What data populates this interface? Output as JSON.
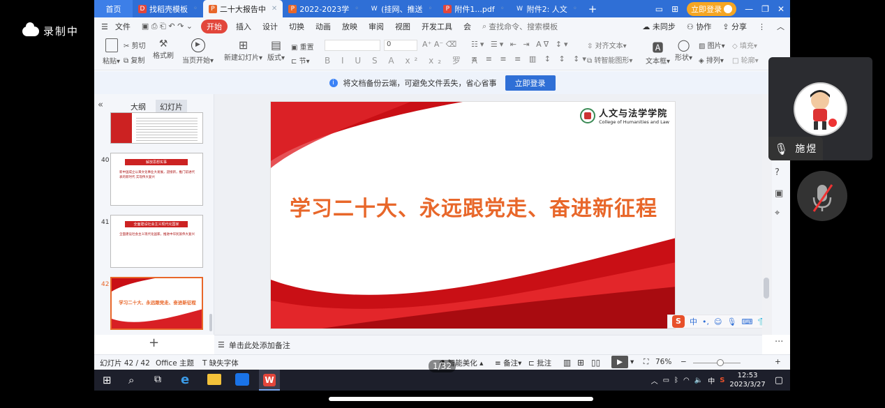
{
  "recording": {
    "label": "录制中"
  },
  "tabs": [
    {
      "label": "首页",
      "type": "home"
    },
    {
      "label": "找稻壳模板",
      "icon": "docer-icon",
      "color": "#e2463b"
    },
    {
      "label": "二十大报告中",
      "icon": "ppt-icon",
      "color": "#e8672a",
      "active": true
    },
    {
      "label": "2022-2023学",
      "icon": "ppt-icon",
      "color": "#e8672a"
    },
    {
      "label": "(挂网、推送",
      "icon": "word-icon",
      "color": "#2f6fd6"
    },
    {
      "label": "附件1...pdf",
      "icon": "pdf-icon",
      "color": "#e2463b"
    },
    {
      "label": "附件2: 人文",
      "icon": "word-icon",
      "color": "#2f6fd6"
    }
  ],
  "top_login": "立即登录",
  "menu": {
    "file": "文件",
    "items": [
      "开始",
      "插入",
      "设计",
      "切换",
      "动画",
      "放映",
      "审阅",
      "视图",
      "开发工具",
      "会"
    ],
    "active": "开始",
    "search_placeholder": "查找命令、搜索模板",
    "unsynced": "未同步",
    "collab": "协作",
    "share": "分享"
  },
  "ribbon": {
    "paste": "粘贴",
    "cut": "剪切",
    "copy": "复制",
    "format_painter": "格式刷",
    "from_current": "当页开始",
    "new_slide": "新建幻灯片",
    "layout": "版式",
    "section": "节",
    "reset": "重置",
    "font_size": "0",
    "align_text": "对齐文本",
    "smartart": "转智能图形",
    "textbox": "文本框",
    "shape": "形状",
    "picture": "图片",
    "arrange": "排列",
    "fill": "填充",
    "outline": "轮廓"
  },
  "notify": {
    "text": "将文档备份云端，可避免文件丢失，省心省事",
    "button": "立即登录"
  },
  "panel": {
    "outline_tab": "大纲",
    "slides_tab": "幻灯片"
  },
  "thumbs": [
    {
      "num": "40",
      "title": "解放思想实事",
      "body": "新中国成立以来文化事业大发展，迎接新，推门前进代表的新时代 实现伟大复兴"
    },
    {
      "num": "41",
      "title": "全面建设社会主义现代化国家",
      "body": "全面建设社会主义现代化国家，推进中华民族伟大复兴"
    },
    {
      "num": "42",
      "title": "学习二十大、永远跟党走、奋进新征程",
      "selected": true
    }
  ],
  "slide": {
    "title": "学习二十大、永远跟党走、奋进新征程",
    "logo_cn": "人文与法学学院",
    "logo_en": "College of Humanities and Law"
  },
  "notes_placeholder": "单击此处添加备注",
  "status": {
    "slide_info": "幻灯片 42 / 42",
    "theme": "Office 主题",
    "missing_font": "缺失字体",
    "beautify": "智能美化",
    "notes": "备注",
    "comments": "批注",
    "zoom": "76%"
  },
  "pager": "1/32",
  "tray": {
    "ime": "中",
    "time": "12:53",
    "date": "2023/3/27"
  },
  "participant": {
    "name": "施煜"
  },
  "sogou": {
    "mode": "中"
  }
}
